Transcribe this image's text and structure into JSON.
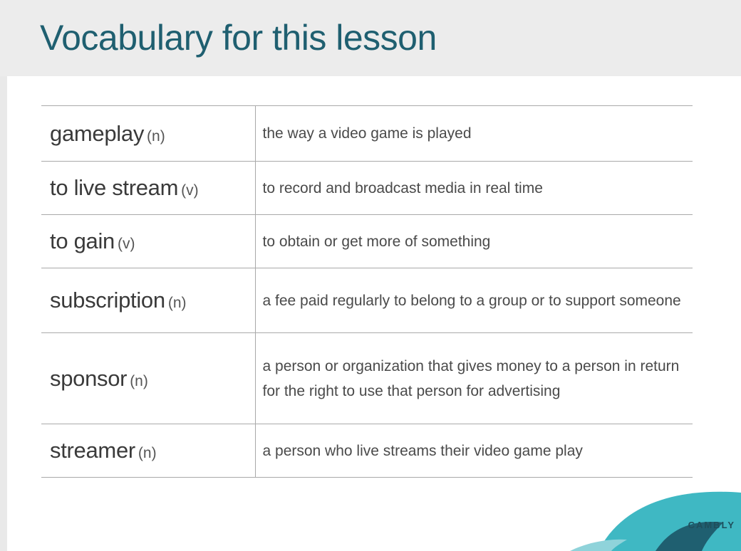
{
  "header": {
    "title": "Vocabulary for this lesson"
  },
  "vocabulary": [
    {
      "word": "gameplay",
      "pos": "(n)",
      "definition": "the way a video game is played"
    },
    {
      "word": "to live stream",
      "pos": "(v)",
      "definition": "to record and broadcast media in real time"
    },
    {
      "word": "to gain",
      "pos": "(v)",
      "definition": "to obtain or get more of something"
    },
    {
      "word": "subscription",
      "pos": "(n)",
      "definition": "a fee paid regularly to belong to a group or to support someone"
    },
    {
      "word": "sponsor",
      "pos": "(n)",
      "definition": "a person or organization that gives money to a person in return for the right to use that person for advertising"
    },
    {
      "word": "streamer",
      "pos": "(n)",
      "definition": "a person who live streams their video game play"
    }
  ],
  "brand": {
    "name": "CAMBLY"
  },
  "colors": {
    "title": "#1f5f70",
    "header_bg": "#ececec",
    "brand_teal": "#3fb8c3",
    "brand_dark": "#1f5f70"
  }
}
